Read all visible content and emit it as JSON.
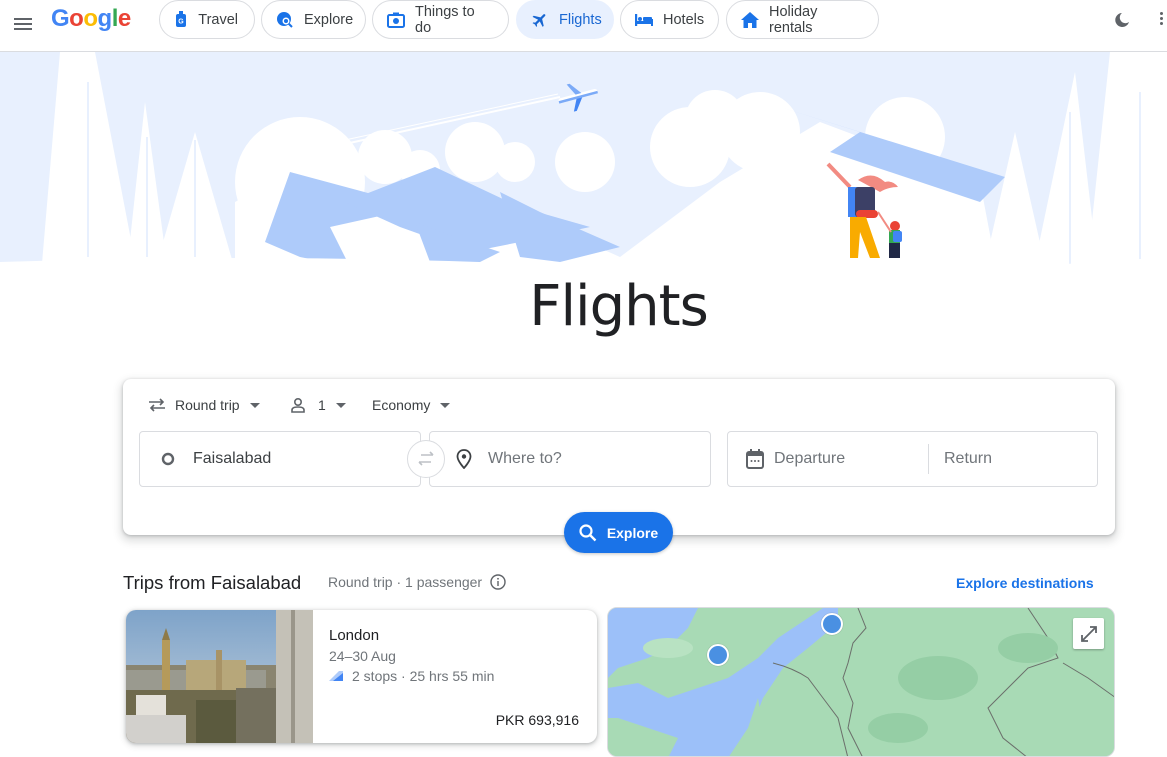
{
  "header": {
    "logo": "Google",
    "nav_chips": [
      {
        "label": "Travel",
        "icon": "travel-icon",
        "active": false
      },
      {
        "label": "Explore",
        "icon": "explore-icon",
        "active": false
      },
      {
        "label": "Things to do",
        "icon": "things-to-do-icon",
        "active": false
      },
      {
        "label": "Flights",
        "icon": "flight-icon",
        "active": true
      },
      {
        "label": "Hotels",
        "icon": "hotel-icon",
        "active": false
      },
      {
        "label": "Holiday rentals",
        "icon": "home-icon",
        "active": false
      }
    ]
  },
  "page_title": "Flights",
  "search": {
    "trip_type": "Round trip",
    "passengers": "1",
    "cabin_class": "Economy",
    "origin": "Faisalabad",
    "destination_placeholder": "Where to?",
    "departure_placeholder": "Departure",
    "return_placeholder": "Return",
    "explore_button": "Explore"
  },
  "trips": {
    "title": "Trips from Faisalabad",
    "subtitle": "Round trip · 1 passenger",
    "explore_link": "Explore destinations",
    "cards": [
      {
        "city": "London",
        "dates": "24–30 Aug",
        "stops": "2 stops · 25 hrs 55 min",
        "price": "PKR 693,916"
      }
    ]
  },
  "colors": {
    "accent": "#1a73e8",
    "active_chip_bg": "#e8f0fe",
    "map_water": "#9cc0f9",
    "map_land": "#a8dab5"
  }
}
